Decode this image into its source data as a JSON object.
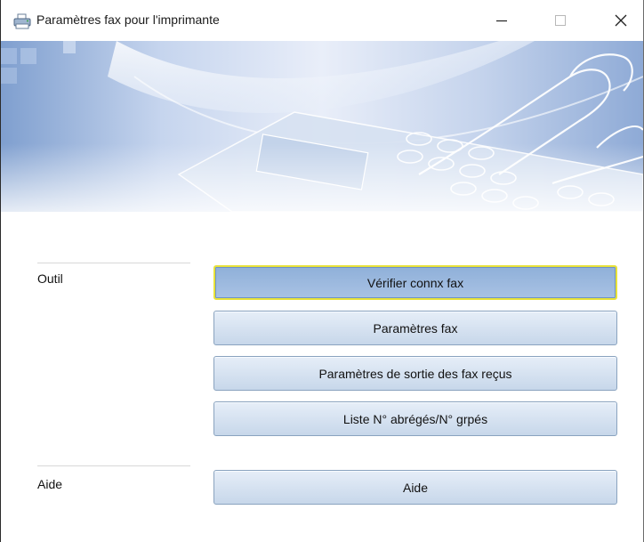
{
  "window": {
    "title": "Paramètres fax pour l'imprimante",
    "controls": {
      "minimize": "—",
      "maximize": "☐",
      "close": "✕"
    }
  },
  "banner": {
    "image": "fax-keypad-hand-banner",
    "colors": {
      "accent": "#8fb0d9",
      "light": "#eef3fb"
    }
  },
  "sections": {
    "tool": {
      "label": "Outil",
      "buttons": [
        {
          "label": "Vérifier connx fax",
          "focused": true
        },
        {
          "label": "Paramètres fax",
          "focused": false
        },
        {
          "label": "Paramètres de sortie des fax reçus",
          "focused": false
        },
        {
          "label": "Liste N° abrégés/N° grpés",
          "focused": false
        }
      ]
    },
    "help": {
      "label": "Aide",
      "buttons": [
        {
          "label": "Aide",
          "focused": false
        }
      ]
    }
  }
}
